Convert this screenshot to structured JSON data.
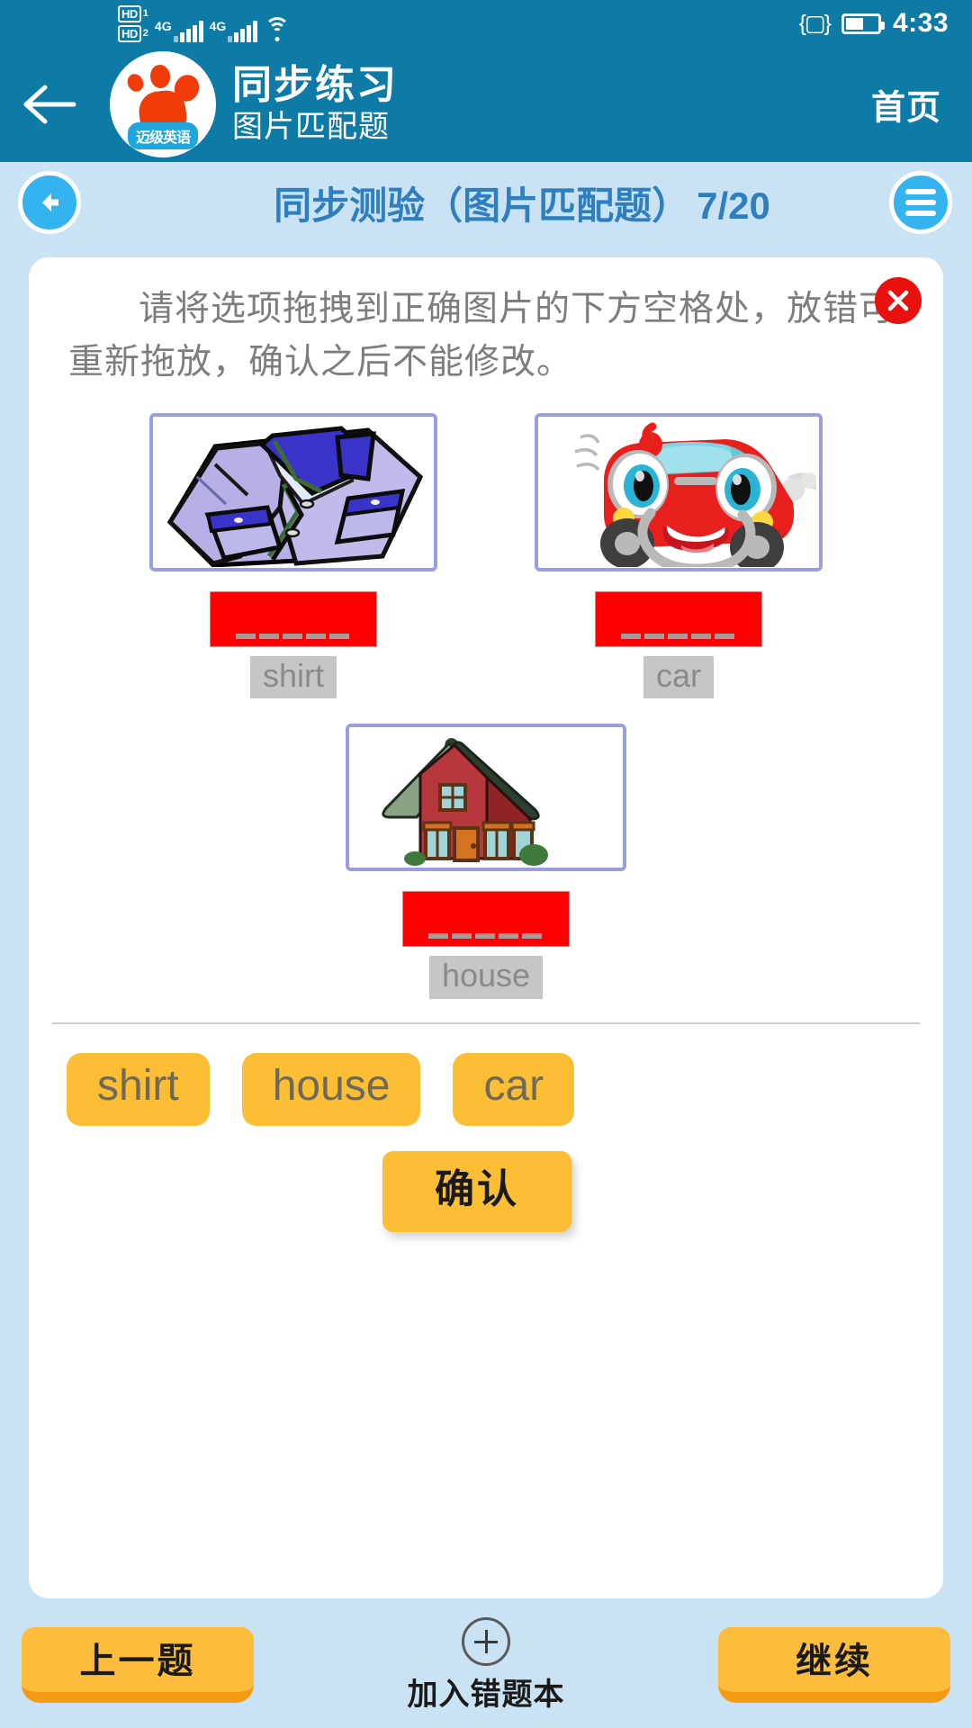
{
  "status_bar": {
    "hd1_label": "HD",
    "hd1_sub": "1",
    "hd2_label": "HD",
    "hd2_sub": "2",
    "network_1": "4G",
    "network_2": "4G",
    "wifi_icon": "wifi-icon",
    "vibrate_icon": "vibrate-icon",
    "battery_icon": "battery-icon",
    "time": "4:33"
  },
  "header": {
    "back_icon": "back-arrow-icon",
    "logo_icon": "paw-logo-icon",
    "logo_badge": "迈级英语",
    "title": "同步练习",
    "subtitle": "图片匹配题",
    "home_label": "首页"
  },
  "subheader": {
    "back_icon": "circle-back-arrow-icon",
    "title": "同步测验（图片匹配题）",
    "counter": "7/20",
    "menu_icon": "hamburger-menu-icon"
  },
  "card": {
    "close_icon": "close-x-icon",
    "instruction": "请将选项拖拽到正确图片的下方空格处，放错可重新拖放，确认之后不能修改。"
  },
  "questions": [
    {
      "image_icon": "shirt-image",
      "answer": "shirt",
      "dropzone_state": "filled-red"
    },
    {
      "image_icon": "car-image",
      "answer": "car",
      "dropzone_state": "filled-red"
    },
    {
      "image_icon": "house-image",
      "answer": "house",
      "dropzone_state": "filled-red"
    }
  ],
  "options": [
    {
      "label": "shirt"
    },
    {
      "label": "house"
    },
    {
      "label": "car"
    }
  ],
  "confirm": {
    "label": "确认"
  },
  "bottom_bar": {
    "prev_label": "上一题",
    "wrongbook_icon": "plus-circle-icon",
    "wrongbook_label": "加入错题本",
    "next_label": "继续"
  },
  "colors": {
    "header_blue": "#0d7ba6",
    "page_blue": "#c9e3f5",
    "accent_amber": "#fbbe35",
    "dropzone_red": "#fe0000",
    "title_blue": "#2f7fbf"
  }
}
